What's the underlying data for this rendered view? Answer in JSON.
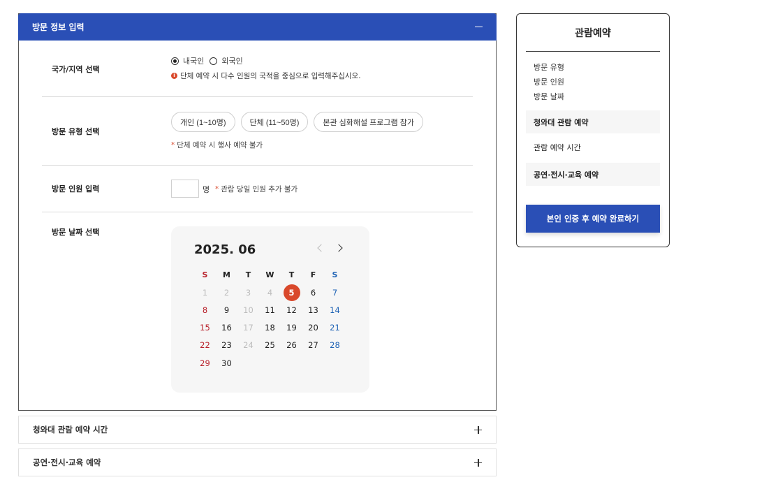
{
  "panel": {
    "title": "방문 정보 입력"
  },
  "nationality": {
    "label": "국가/지역 선택",
    "options": [
      "내국인",
      "외국인"
    ],
    "selected": "내국인",
    "notice": "단체 예약 시 다수 인원의 국적을 중심으로 입력해주십시오."
  },
  "visit_type": {
    "label": "방문 유형 선택",
    "options": [
      "개인 (1~10명)",
      "단체 (11~50명)",
      "본관 심화해설 프로그램 참가"
    ],
    "note": "단체 예약 시 행사 예약 불가"
  },
  "visitors": {
    "label": "방문 인원 입력",
    "value": "",
    "unit": "명",
    "note": "관람 당일 인원 추가 불가"
  },
  "visit_date": {
    "label": "방문 날짜 선택",
    "month": "2025. 06",
    "weekdays": [
      "S",
      "M",
      "T",
      "W",
      "T",
      "F",
      "S"
    ],
    "days": [
      "1",
      "2",
      "3",
      "4",
      "5",
      "6",
      "7",
      "8",
      "9",
      "10",
      "11",
      "12",
      "13",
      "14",
      "15",
      "16",
      "17",
      "18",
      "19",
      "20",
      "21",
      "22",
      "23",
      "24",
      "25",
      "26",
      "27",
      "28",
      "29",
      "30"
    ],
    "disabled_days": [
      "1",
      "2",
      "3",
      "4",
      "10",
      "17",
      "24"
    ],
    "today": "5"
  },
  "accordions": [
    "청와대 관람 예약 시간",
    "공연·전시·교육 예약"
  ],
  "sidebar": {
    "title": "관람예약",
    "items": [
      "방문 유형",
      "방문 인원",
      "방문 날짜"
    ],
    "blocks": [
      "청와대 관람 예약",
      "관람 예약 시간",
      "공연·전시·교육 예약"
    ],
    "submit_label": "본인 인증 후 예약 완료하기"
  },
  "colors": {
    "primary": "#2a4fb6",
    "accent": "#d9482b",
    "sunday": "#b8202a",
    "saturday": "#1f63b5"
  }
}
